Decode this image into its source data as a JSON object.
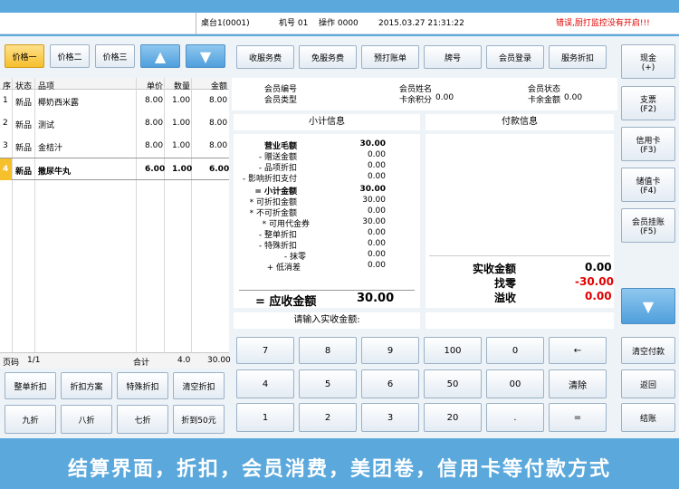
{
  "header": {
    "table": "桌台1(0001)",
    "machine": "机号 01",
    "operator": "操作 0000",
    "datetime": "2015.03.27 21:31:22",
    "warning": "错误,厨打监控没有开启!!!"
  },
  "price_tabs": [
    "价格一",
    "价格二",
    "价格三"
  ],
  "order_table": {
    "headers": [
      "序",
      "状态",
      "品项",
      "单价",
      "数量",
      "金额"
    ],
    "rows": [
      {
        "no": "1",
        "status": "新品",
        "item": "椰奶西米露",
        "price": "8.00",
        "qty": "1.00",
        "amount": "8.00"
      },
      {
        "no": "2",
        "status": "新品",
        "item": "测试",
        "price": "8.00",
        "qty": "1.00",
        "amount": "8.00"
      },
      {
        "no": "3",
        "status": "新品",
        "item": "金桔汁",
        "price": "8.00",
        "qty": "1.00",
        "amount": "8.00"
      },
      {
        "no": "4",
        "status": "新品",
        "item": "撒尿牛丸",
        "price": "6.00",
        "qty": "1.00",
        "amount": "6.00"
      }
    ],
    "footer": {
      "page_label": "页码",
      "page": "1/1",
      "total_label": "合计",
      "total_qty": "4.0",
      "total_amount": "30.00"
    }
  },
  "discount_buttons": [
    "整单折扣",
    "折扣方案",
    "特殊折扣",
    "清空折扣",
    "九折",
    "八折",
    "七折",
    "折到50元"
  ],
  "function_buttons": [
    "收服务费",
    "免服务费",
    "预打账单",
    "牌号",
    "会员登录",
    "服务折扣"
  ],
  "member": {
    "no_label": "会员编号",
    "type_label": "会员类型",
    "name_label": "会员姓名",
    "points_label": "卡余积分",
    "points": "0.00",
    "status_label": "会员状态",
    "balance_label": "卡余金额",
    "balance": "0.00"
  },
  "subtotal_title": "小计信息",
  "payment_title": "付款信息",
  "subtotal_lines": [
    {
      "label": "营业毛额",
      "value": "30.00"
    },
    {
      "label": "- 赠送金额",
      "value": "0.00"
    },
    {
      "label": "- 品项折扣",
      "value": "0.00"
    },
    {
      "label": "- 影响折扣支付",
      "value": "0.00"
    },
    {
      "label": "= 小计金额",
      "value": "30.00"
    },
    {
      "label": "* 可折扣金额",
      "value": "30.00"
    },
    {
      "label": "* 不可折金额",
      "value": "0.00"
    },
    {
      "label": "* 可用代金券",
      "value": "30.00"
    },
    {
      "label": "- 整单折扣",
      "value": "0.00"
    },
    {
      "label": "- 特殊折扣",
      "value": "0.00"
    },
    {
      "label": "- 抹零",
      "value": "0.00"
    },
    {
      "label": "+ 低消差",
      "value": "0.00"
    }
  ],
  "due_label": "= 应收金额",
  "due_value": "30.00",
  "payment": {
    "received_label": "实收金额",
    "received": "0.00",
    "change_label": "找零",
    "change": "-30.00",
    "overflow_label": "溢收",
    "overflow": "0.00"
  },
  "input_prompt": "请输入实收金额:",
  "keypad": [
    "7",
    "8",
    "9",
    "100",
    "0",
    "←",
    "4",
    "5",
    "6",
    "50",
    "00",
    "清除",
    "1",
    "2",
    "3",
    "20",
    ".",
    "="
  ],
  "pay_methods": [
    {
      "name": "现金",
      "key": "(+)"
    },
    {
      "name": "支票",
      "key": "(F2)"
    },
    {
      "name": "信用卡",
      "key": "(F3)"
    },
    {
      "name": "储值卡",
      "key": "(F4)"
    },
    {
      "name": "会员挂账",
      "key": "(F5)"
    }
  ],
  "right_bottom_buttons": [
    "清空付款",
    "返回",
    "结账"
  ],
  "banner": "结算界面，折扣，会员消费，美团卷，信用卡等付款方式",
  "colors": {
    "accent": "#5aa8dc",
    "warning": "#e00000",
    "selected": "#f6bf2c",
    "highlight_row": "#f6bf2c"
  },
  "icons": [
    "arrow-up-icon",
    "arrow-down-icon",
    "backspace-arrow-icon"
  ]
}
